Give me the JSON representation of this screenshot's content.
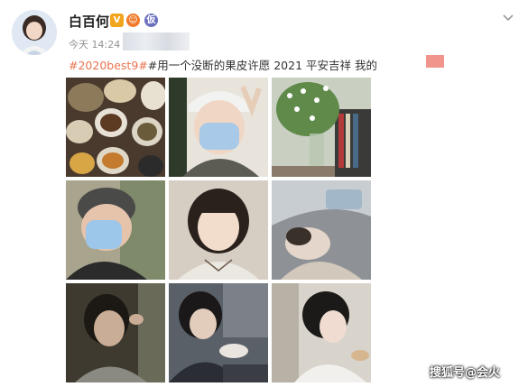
{
  "post": {
    "username": "白百何",
    "badges": {
      "vip": "V",
      "level": "☺",
      "extra": "仮"
    },
    "timestamp": "今天 14:24",
    "text": {
      "hashtag": "#2020best9#",
      "body": "#用一个没断的果皮许愿 2021 平安吉祥 我的"
    }
  },
  "photos": [
    {
      "name": "food-table-photo"
    },
    {
      "name": "selfie-mask-cap-photo"
    },
    {
      "name": "flowers-vase-photo"
    },
    {
      "name": "man-mask-photo"
    },
    {
      "name": "woman-bangs-photo"
    },
    {
      "name": "car-interior-photo"
    },
    {
      "name": "woman-dark-room-photo"
    },
    {
      "name": "woman-cafe-photo"
    },
    {
      "name": "woman-profile-photo"
    }
  ],
  "watermark": "搜狐号@会火",
  "icons": {
    "more": "chevron-down-icon"
  }
}
